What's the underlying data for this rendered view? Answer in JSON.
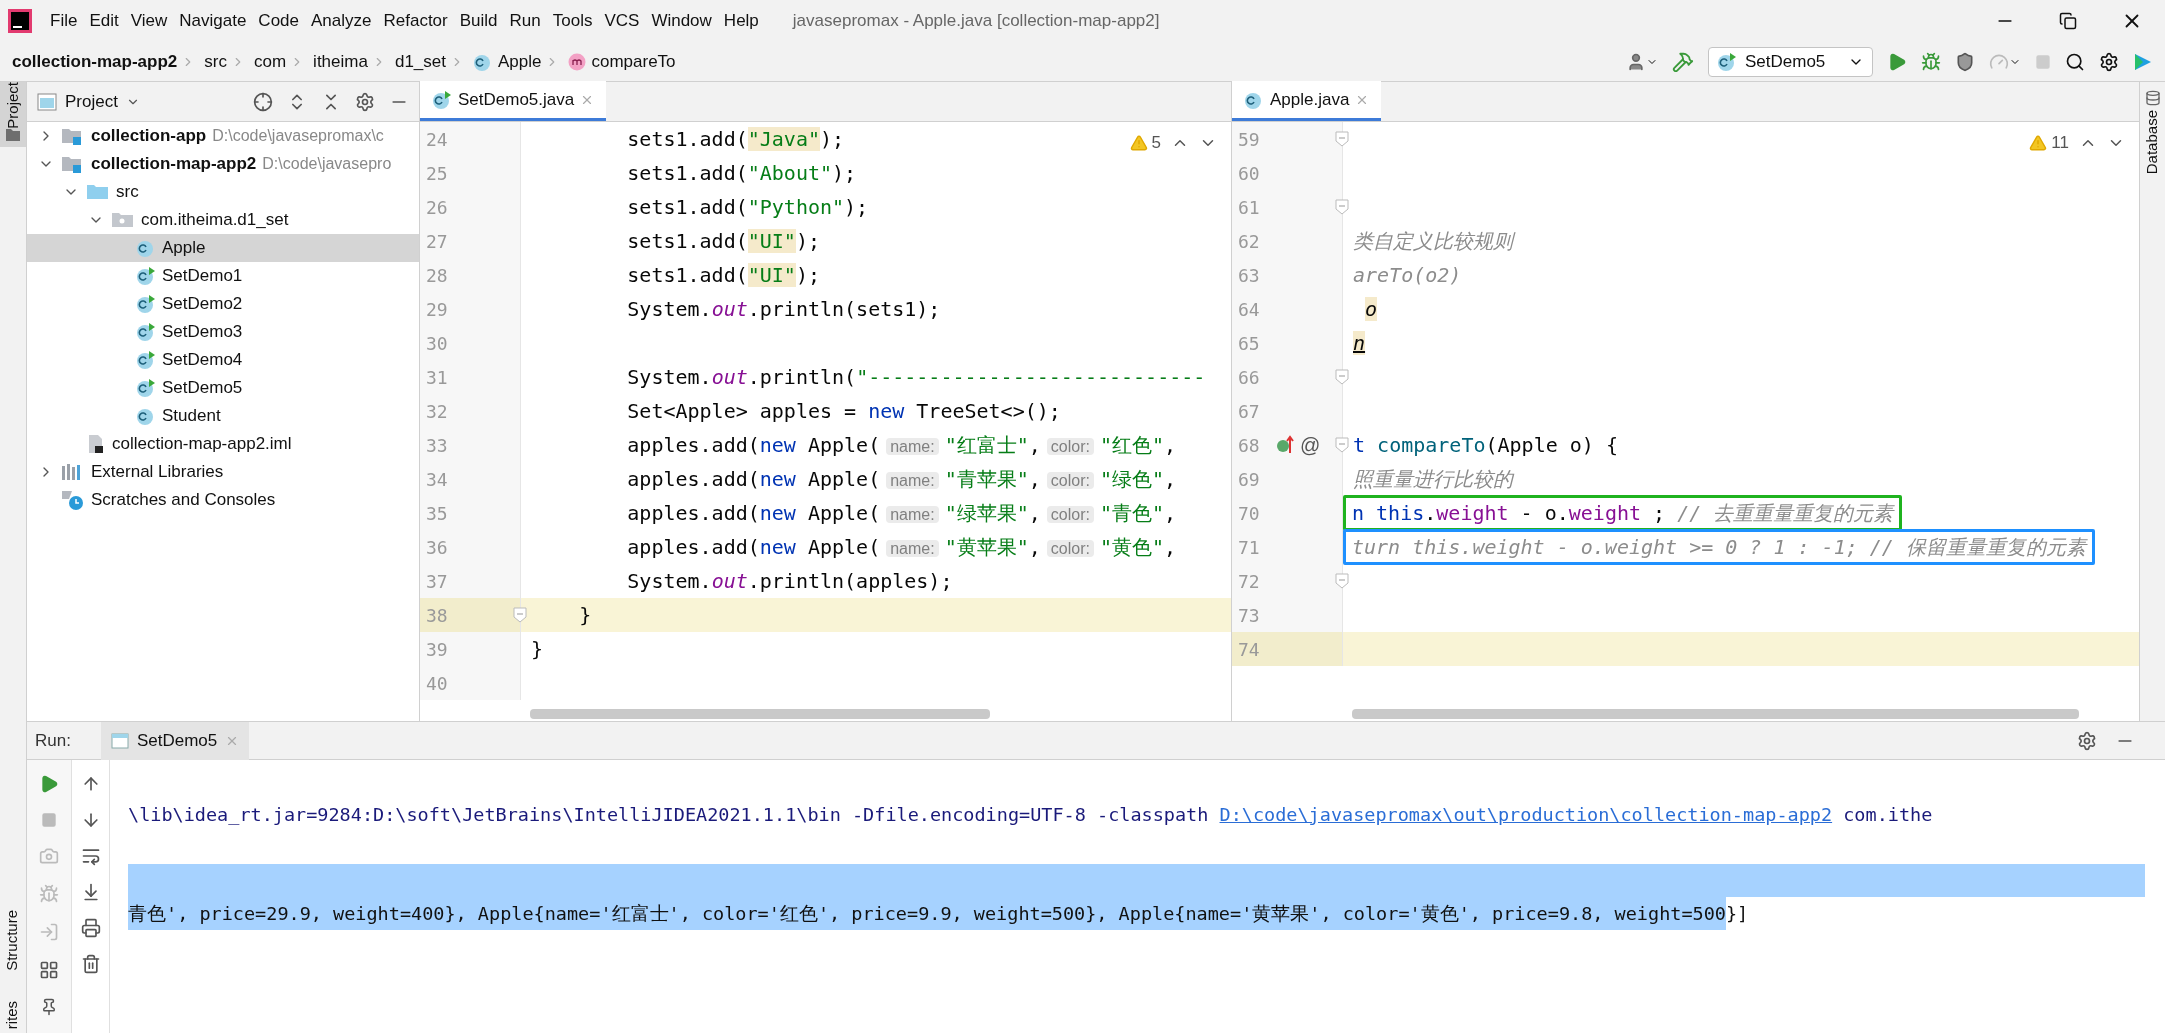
{
  "menu_bar": {
    "items": [
      "File",
      "Edit",
      "View",
      "Navigate",
      "Code",
      "Analyze",
      "Refactor",
      "Build",
      "Run",
      "Tools",
      "VCS",
      "Window",
      "Help"
    ],
    "title": "javasepromax - Apple.java [collection-map-app2]"
  },
  "breadcrumb": [
    {
      "label": "collection-map-app2",
      "kind": "project"
    },
    {
      "label": "src",
      "kind": "dir"
    },
    {
      "label": "com",
      "kind": "dir"
    },
    {
      "label": "itheima",
      "kind": "dir"
    },
    {
      "label": "d1_set",
      "kind": "dir"
    },
    {
      "label": "Apple",
      "kind": "class"
    },
    {
      "label": "compareTo",
      "kind": "method"
    }
  ],
  "run_config": "SetDemo5",
  "left_stripe": {
    "top": [
      {
        "label": "Project",
        "selected": true
      }
    ],
    "bottom": [
      {
        "label": "Structure",
        "selected": false
      },
      {
        "label": "rites",
        "selected": false
      }
    ]
  },
  "right_stripe": [
    {
      "label": "Database",
      "selected": false
    }
  ],
  "project_panel": {
    "title": "Project",
    "tree": [
      {
        "label": "collection-app",
        "path": "D:\\code\\javasepromax\\c",
        "kind": "module",
        "expanded": false,
        "selected": false
      },
      {
        "label": "collection-map-app2",
        "path": "D:\\code\\javasepro",
        "kind": "module",
        "expanded": true,
        "selected": false,
        "children": [
          {
            "label": "src",
            "kind": "folder",
            "expanded": true,
            "selected": false,
            "children": [
              {
                "label": "com.itheima.d1_set",
                "kind": "package",
                "expanded": true,
                "selected": false,
                "children": [
                  {
                    "label": "Apple",
                    "kind": "class",
                    "selected": true
                  },
                  {
                    "label": "SetDemo1",
                    "kind": "runclass",
                    "selected": false
                  },
                  {
                    "label": "SetDemo2",
                    "kind": "runclass",
                    "selected": false
                  },
                  {
                    "label": "SetDemo3",
                    "kind": "runclass",
                    "selected": false
                  },
                  {
                    "label": "SetDemo4",
                    "kind": "runclass",
                    "selected": false
                  },
                  {
                    "label": "SetDemo5",
                    "kind": "runclass",
                    "selected": false
                  },
                  {
                    "label": "Student",
                    "kind": "class",
                    "selected": false
                  }
                ]
              }
            ]
          },
          {
            "label": "collection-map-app2.iml",
            "kind": "iml",
            "selected": false
          }
        ]
      },
      {
        "label": "External Libraries",
        "kind": "libraries",
        "expanded": false,
        "selected": false
      },
      {
        "label": "Scratches and Consoles",
        "kind": "scratches",
        "selected": false
      }
    ]
  },
  "editors": [
    {
      "tab": {
        "label": "SetDemo5.java",
        "kind": "runclass",
        "selected": true
      },
      "warnings": "5",
      "lines": [
        {
          "num": "24",
          "fold": false,
          "current": false,
          "tokens": [
            {
              "kind": "plain",
              "text": "        sets1.add("
            },
            {
              "kind": "strmark",
              "text": "\"Java\""
            },
            {
              "kind": "plain",
              "text": ");"
            }
          ]
        },
        {
          "num": "25",
          "fold": false,
          "current": false,
          "tokens": [
            {
              "kind": "plain",
              "text": "        sets1.add("
            },
            {
              "kind": "str",
              "text": "\"About\""
            },
            {
              "kind": "plain",
              "text": ");"
            }
          ]
        },
        {
          "num": "26",
          "fold": false,
          "current": false,
          "tokens": [
            {
              "kind": "plain",
              "text": "        sets1.add("
            },
            {
              "kind": "str",
              "text": "\"Python\""
            },
            {
              "kind": "plain",
              "text": ");"
            }
          ]
        },
        {
          "num": "27",
          "fold": false,
          "current": false,
          "tokens": [
            {
              "kind": "plain",
              "text": "        sets1.add("
            },
            {
              "kind": "strmark",
              "text": "\"UI\""
            },
            {
              "kind": "plain",
              "text": ");"
            }
          ]
        },
        {
          "num": "28",
          "fold": false,
          "current": false,
          "tokens": [
            {
              "kind": "plain",
              "text": "        sets1.add("
            },
            {
              "kind": "strmark",
              "text": "\"UI\""
            },
            {
              "kind": "plain",
              "text": ");"
            }
          ]
        },
        {
          "num": "29",
          "fold": false,
          "current": false,
          "tokens": [
            {
              "kind": "plain",
              "text": "        System."
            },
            {
              "kind": "field",
              "text": "out"
            },
            {
              "kind": "plain",
              "text": ".println(sets1);"
            }
          ]
        },
        {
          "num": "30",
          "fold": false,
          "current": false
        },
        {
          "num": "31",
          "fold": false,
          "current": false,
          "tokens": [
            {
              "kind": "plain",
              "text": "        System."
            },
            {
              "kind": "field",
              "text": "out"
            },
            {
              "kind": "plain",
              "text": ".println("
            },
            {
              "kind": "str",
              "text": "\"----------------------------"
            }
          ]
        },
        {
          "num": "32",
          "fold": false,
          "current": false,
          "tokens": [
            {
              "kind": "plain",
              "text": "        Set<Apple> apples = "
            },
            {
              "kind": "kw",
              "text": "new"
            },
            {
              "kind": "plain",
              "text": " TreeSet<>();"
            }
          ]
        },
        {
          "num": "33",
          "fold": false,
          "current": false,
          "tokens": [
            {
              "kind": "plain",
              "text": "        apples.add("
            },
            {
              "kind": "kw",
              "text": "new"
            },
            {
              "kind": "plain",
              "text": " Apple("
            },
            {
              "kind": "hint",
              "text": "name:"
            },
            {
              "kind": "str",
              "text": "\"红富士\""
            },
            {
              "kind": "plain",
              "text": ","
            },
            {
              "kind": "hint",
              "text": "color:"
            },
            {
              "kind": "str",
              "text": "\"红色\""
            },
            {
              "kind": "plain",
              "text": ","
            }
          ]
        },
        {
          "num": "34",
          "fold": false,
          "current": false,
          "tokens": [
            {
              "kind": "plain",
              "text": "        apples.add("
            },
            {
              "kind": "kw",
              "text": "new"
            },
            {
              "kind": "plain",
              "text": " Apple("
            },
            {
              "kind": "hint",
              "text": "name:"
            },
            {
              "kind": "str",
              "text": "\"青苹果\""
            },
            {
              "kind": "plain",
              "text": ","
            },
            {
              "kind": "hint",
              "text": "color:"
            },
            {
              "kind": "str",
              "text": "\"绿色\""
            },
            {
              "kind": "plain",
              "text": ","
            }
          ]
        },
        {
          "num": "35",
          "fold": false,
          "current": false,
          "tokens": [
            {
              "kind": "plain",
              "text": "        apples.add("
            },
            {
              "kind": "kw",
              "text": "new"
            },
            {
              "kind": "plain",
              "text": " Apple("
            },
            {
              "kind": "hint",
              "text": "name:"
            },
            {
              "kind": "str",
              "text": "\"绿苹果\""
            },
            {
              "kind": "plain",
              "text": ","
            },
            {
              "kind": "hint",
              "text": "color:"
            },
            {
              "kind": "str",
              "text": "\"青色\""
            },
            {
              "kind": "plain",
              "text": ","
            }
          ]
        },
        {
          "num": "36",
          "fold": false,
          "current": false,
          "tokens": [
            {
              "kind": "plain",
              "text": "        apples.add("
            },
            {
              "kind": "kw",
              "text": "new"
            },
            {
              "kind": "plain",
              "text": " Apple("
            },
            {
              "kind": "hint",
              "text": "name:"
            },
            {
              "kind": "str",
              "text": "\"黄苹果\""
            },
            {
              "kind": "plain",
              "text": ","
            },
            {
              "kind": "hint",
              "text": "color:"
            },
            {
              "kind": "str",
              "text": "\"黄色\""
            },
            {
              "kind": "plain",
              "text": ","
            }
          ]
        },
        {
          "num": "37",
          "fold": false,
          "current": false,
          "tokens": [
            {
              "kind": "plain",
              "text": "        System."
            },
            {
              "kind": "field",
              "text": "out"
            },
            {
              "kind": "plain",
              "text": ".println(apples);"
            }
          ]
        },
        {
          "num": "38",
          "fold": true,
          "current": true,
          "tokens": [
            {
              "kind": "plain",
              "text": "    }"
            }
          ]
        },
        {
          "num": "39",
          "fold": false,
          "current": false,
          "tokens": [
            {
              "kind": "plain",
              "text": "}"
            }
          ]
        },
        {
          "num": "40",
          "fold": false,
          "current": false
        }
      ]
    },
    {
      "tab": {
        "label": "Apple.java",
        "kind": "class",
        "selected": true
      },
      "warnings": "11",
      "lines": [
        {
          "num": "59",
          "fold": true,
          "current": false,
          "annotated": false
        },
        {
          "num": "60",
          "fold": false,
          "current": false,
          "annotated": false
        },
        {
          "num": "61",
          "fold": true,
          "current": false,
          "annotated": false
        },
        {
          "num": "62",
          "fold": false,
          "current": false,
          "annotated": false,
          "tokens": [
            {
              "kind": "comment",
              "text": "类自定义比较规则"
            }
          ]
        },
        {
          "num": "63",
          "fold": false,
          "current": false,
          "annotated": false,
          "tokens": [
            {
              "kind": "comment",
              "text": "areTo(o2)"
            }
          ]
        },
        {
          "num": "64",
          "fold": false,
          "current": false,
          "annotated": false,
          "tokens": [
            {
              "kind": "mark",
              "text": "o"
            }
          ]
        },
        {
          "num": "65",
          "fold": false,
          "current": false,
          "annotated": false,
          "tokens": [
            {
              "kind": "marku",
              "text": "n"
            }
          ]
        },
        {
          "num": "66",
          "fold": true,
          "current": false,
          "annotated": false
        },
        {
          "num": "67",
          "fold": false,
          "current": false,
          "annotated": false
        },
        {
          "num": "68",
          "fold": true,
          "current": false,
          "annotated": true,
          "annotation": "@",
          "tokens": [
            {
              "kind": "kw",
              "text": "t"
            },
            {
              "kind": "method",
              "text": " compareTo"
            },
            {
              "kind": "plain",
              "text": "(Apple o) {"
            }
          ]
        },
        {
          "num": "69",
          "fold": false,
          "current": false,
          "annotated": false,
          "tokens": [
            {
              "kind": "comment",
              "text": "照重量进行比较的"
            }
          ]
        },
        {
          "num": "70",
          "fold": false,
          "current": false,
          "annotated": false,
          "color": "#1fb31f",
          "tokens": [
            {
              "kind": "kw",
              "text": "n this"
            },
            {
              "kind": "plain",
              "text": "."
            },
            {
              "kind": "member",
              "text": "weight"
            },
            {
              "kind": "plain",
              "text": " - o."
            },
            {
              "kind": "member",
              "text": "weight"
            },
            {
              "kind": "plain",
              "text": " ; "
            },
            {
              "kind": "comment",
              "text": "// 去重重量重复的元素"
            }
          ]
        },
        {
          "num": "71",
          "fold": false,
          "current": false,
          "annotated": false,
          "color": "#1e90ff",
          "tokens": [
            {
              "kind": "comment",
              "text": "turn this.weight - o.weight >= 0 ? 1 : -1; // 保留重量重复的元素"
            }
          ]
        },
        {
          "num": "72",
          "fold": true,
          "current": false,
          "annotated": false
        },
        {
          "num": "73",
          "fold": false,
          "current": false,
          "annotated": false
        },
        {
          "num": "74",
          "fold": false,
          "current": true,
          "annotated": false
        }
      ]
    }
  ],
  "run_panel": {
    "label": "Run:",
    "tab": {
      "label": "SetDemo5",
      "selected": true
    },
    "console": [
      {
        "segments": [
          {
            "kind": "cmd",
            "text": "\\lib\\idea_rt.jar=9284:D:\\soft\\JetBrains\\IntelliJIDEA2021.1.1\\bin -Dfile.encoding=UTF-8 -classpath"
          },
          {
            "kind": "link",
            "text": "D:\\code\\javasepromax\\out\\production\\collection-map-app2"
          },
          {
            "kind": "cmd",
            "text": "com.ithe"
          }
        ]
      },
      {
        "selected": false
      },
      {
        "selected": true
      },
      {
        "segments": [
          {
            "kind": "out",
            "selected": true,
            "text": "青色', price=29.9, weight=400}, Apple{name='红富士', color='红色', price=9.9, weight=500}, Apple{name='黄苹果', color='黄色', price=9.8, weight=500"
          },
          {
            "kind": "out",
            "selected": false,
            "text": "}]"
          }
        ]
      }
    ]
  }
}
